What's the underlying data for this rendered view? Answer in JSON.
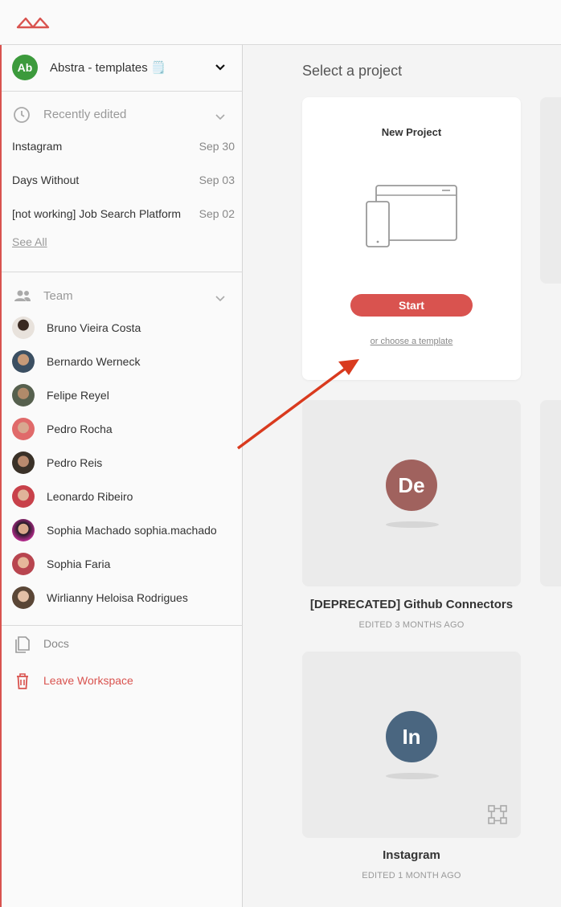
{
  "workspace": {
    "initials": "Ab",
    "name": "Abstra - templates 🗒️"
  },
  "recent": {
    "title": "Recently edited",
    "items": [
      {
        "name": "Instagram",
        "date": "Sep 30"
      },
      {
        "name": "Days Without",
        "date": "Sep 03"
      },
      {
        "name": "[not working] Job Search Platform",
        "date": "Sep 02"
      }
    ],
    "see_all": "See All"
  },
  "team": {
    "title": "Team",
    "members": [
      {
        "name": "Bruno Vieira Costa"
      },
      {
        "name": "Bernardo Werneck"
      },
      {
        "name": "Felipe Reyel"
      },
      {
        "name": "Pedro Rocha"
      },
      {
        "name": "Pedro Reis"
      },
      {
        "name": "Leonardo Ribeiro"
      },
      {
        "name": "Sophia Machado sophia.machado"
      },
      {
        "name": "Sophia Faria"
      },
      {
        "name": "Wirlianny Heloisa Rodrigues"
      }
    ]
  },
  "links": {
    "docs": "Docs",
    "leave": "Leave Workspace"
  },
  "main": {
    "title": "Select a project",
    "new_project": {
      "title": "New Project",
      "start": "Start",
      "template_link": "or choose a template"
    },
    "projects": [
      {
        "initials": "De",
        "name": "[DEPRECATED] Github Connectors",
        "edited": "EDITED 3 MONTHS AGO",
        "color": "#a0625e"
      },
      {
        "initials": "In",
        "name": "Instagram",
        "edited": "EDITED 1 MONTH AGO",
        "color": "#4a6680"
      }
    ]
  },
  "colors": {
    "brand": "#d9534f",
    "workspace_avatar": "#3c9a3c"
  }
}
